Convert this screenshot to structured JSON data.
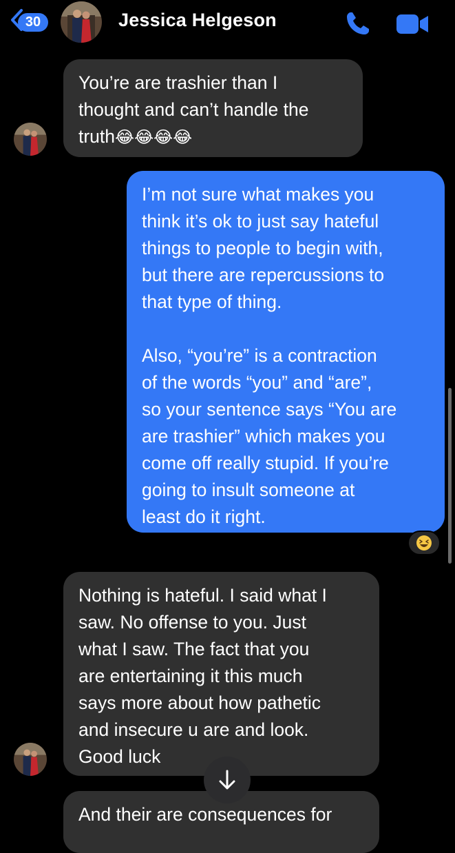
{
  "header": {
    "back_count": "30",
    "contact_name": "Jessica Helgeson",
    "call_icon": "phone-icon",
    "video_icon": "video-camera-icon",
    "accent_color": "#3478f6"
  },
  "messages": [
    {
      "direction": "incoming",
      "text": "You’re are trashier than I\nthought and can’t handle the\ntruth",
      "trailing_emoji": "😂😂😂😂",
      "trailing_emoji_name": "face-with-tears-of-joy-icon"
    },
    {
      "direction": "outgoing",
      "text": "I’m not sure what makes you\nthink it’s ok to just say hateful\nthings to people to begin with,\nbut there are repercussions to\nthat type of thing.\n\nAlso, “you’re” is a contraction\nof the words “you” and “are”,\nso your sentence says “You are\nare trashier” which makes you\ncome off really stupid. If you’re\ngoing to insult someone at\nleast do it right.",
      "reaction": "😆",
      "reaction_icon": "laughing-face-icon"
    },
    {
      "direction": "incoming",
      "text": "Nothing is hateful. I said what I\nsaw. No offense to you. Just\nwhat I saw. The fact that you\nare entertaining it this much\nsays more about how pathetic\nand insecure u are and look.\nGood luck"
    },
    {
      "direction": "incoming",
      "text": "And their are consequences for"
    }
  ],
  "scroll_down_icon": "arrow-down-icon",
  "colors": {
    "incoming_bubble": "#303030",
    "outgoing_bubble": "#3478f6",
    "background": "#000000"
  }
}
